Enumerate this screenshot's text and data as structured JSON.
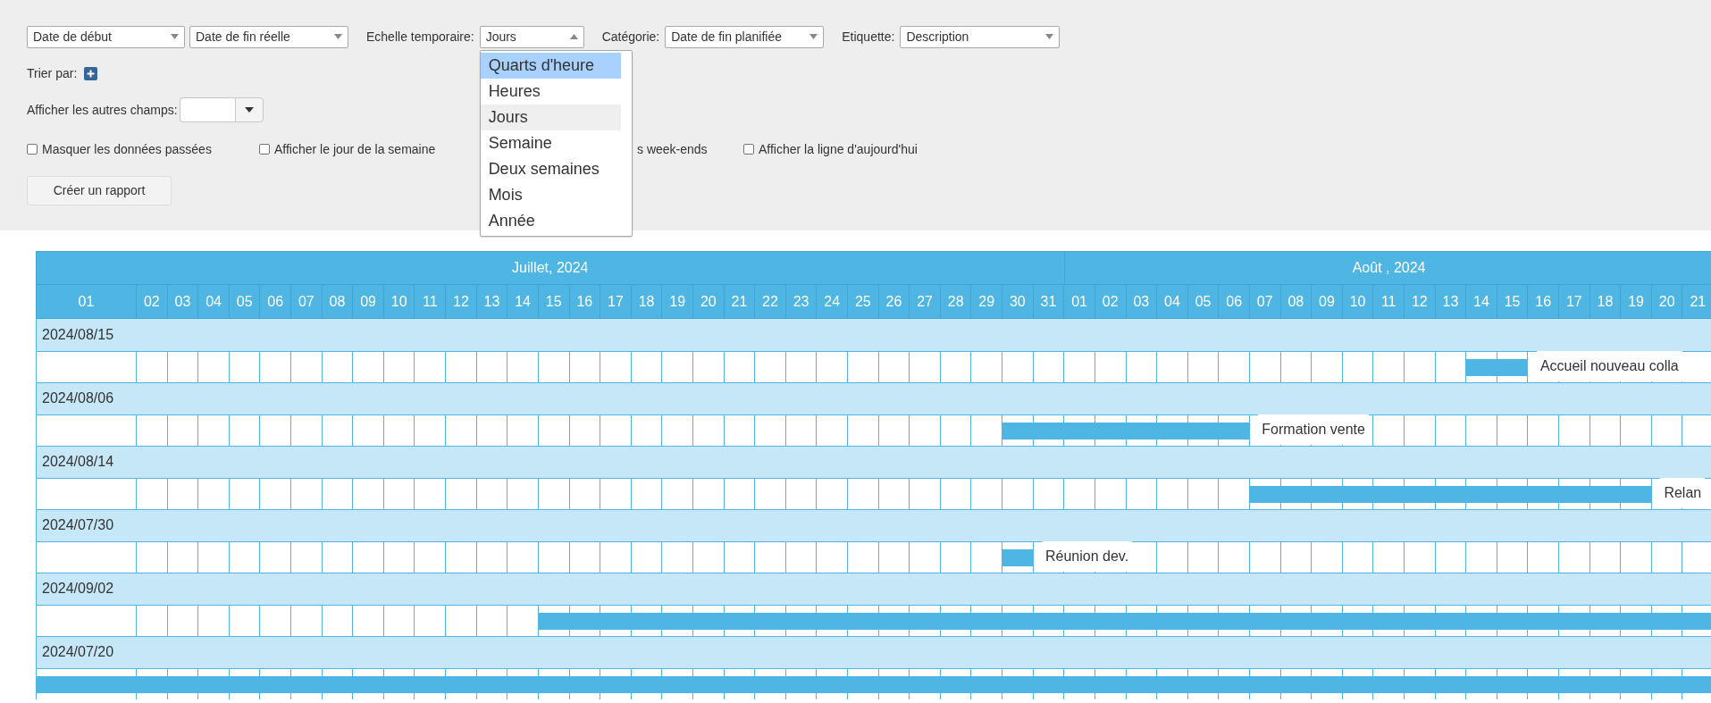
{
  "filters": {
    "selects": [
      {
        "kind": "plain",
        "value": "Date de début",
        "open": false
      },
      {
        "kind": "plain",
        "value": "Date de fin réelle",
        "open": false
      },
      {
        "kind": "labeled",
        "label": "Echelle temporaire:",
        "value": "Jours",
        "open": true
      },
      {
        "kind": "labeled",
        "label": "Catégorie:",
        "value": "Date de fin planifiée",
        "open": false
      },
      {
        "kind": "labeled",
        "label": "Etiquette:",
        "value": "Description",
        "open": false
      }
    ],
    "scale_options": [
      {
        "label": "Quarts d'heure",
        "hovered": true,
        "selected": false
      },
      {
        "label": "Heures",
        "hovered": false,
        "selected": false
      },
      {
        "label": "Jours",
        "hovered": false,
        "selected": true
      },
      {
        "label": "Semaine",
        "hovered": false,
        "selected": false
      },
      {
        "label": "Deux semaines",
        "hovered": false,
        "selected": false
      },
      {
        "label": "Mois",
        "hovered": false,
        "selected": false
      },
      {
        "label": "Année",
        "hovered": false,
        "selected": false
      }
    ],
    "sort_label": "Trier par:",
    "other_fields_label": "Afficher les autres champs:",
    "checkboxes": [
      {
        "label": "Masquer les données passées",
        "checked": false
      },
      {
        "label": "Afficher le jour de la semaine",
        "checked": false
      },
      {
        "label": "s week-ends"
      },
      {
        "label": "Afficher la ligne d'aujourd'hui",
        "checked": false
      }
    ],
    "report_button": "Créer un rapport"
  },
  "gantt": {
    "months": [
      {
        "label": "Juillet, 2024",
        "days": [
          "01",
          "02",
          "03",
          "04",
          "05",
          "06",
          "07",
          "08",
          "09",
          "10",
          "11",
          "12",
          "13",
          "14",
          "15",
          "16",
          "17",
          "18",
          "19",
          "20",
          "21",
          "22",
          "23",
          "24",
          "25",
          "26",
          "27",
          "28",
          "29",
          "30",
          "31"
        ]
      },
      {
        "label": "Août , 2024",
        "days": [
          "01",
          "02",
          "03",
          "04",
          "05",
          "06",
          "07",
          "08",
          "09",
          "10",
          "11",
          "12",
          "13",
          "14",
          "15",
          "16",
          "17",
          "18",
          "19",
          "20",
          "21"
        ]
      }
    ],
    "groups": [
      {
        "title": "2024/08/15",
        "label": "Accueil nouveau colla",
        "cells": [
          false,
          false,
          false,
          false,
          false,
          false,
          false,
          false,
          false,
          false,
          false,
          false,
          false,
          false,
          false,
          false,
          false,
          false,
          false,
          false,
          false,
          false,
          false,
          false,
          false,
          false,
          false,
          false,
          false,
          false,
          false,
          false,
          false,
          false,
          false,
          false,
          false,
          false,
          false,
          false,
          false,
          false,
          false,
          false,
          true,
          true,
          false,
          false,
          false,
          false,
          false,
          false
        ]
      },
      {
        "title": "2024/08/06",
        "label": "Formation vente",
        "cells": [
          false,
          false,
          false,
          false,
          false,
          false,
          false,
          false,
          false,
          false,
          false,
          false,
          false,
          false,
          false,
          false,
          false,
          false,
          false,
          false,
          false,
          false,
          false,
          false,
          false,
          false,
          false,
          false,
          false,
          true,
          true,
          true,
          true,
          true,
          true,
          true,
          true,
          false,
          false,
          false,
          false,
          false,
          false,
          false,
          false,
          false,
          false,
          false,
          false,
          false,
          false,
          false
        ]
      },
      {
        "title": "2024/08/14",
        "label": "Relan",
        "cells": [
          false,
          false,
          false,
          false,
          false,
          false,
          false,
          false,
          false,
          false,
          false,
          false,
          false,
          false,
          false,
          false,
          false,
          false,
          false,
          false,
          false,
          false,
          false,
          false,
          false,
          false,
          false,
          false,
          false,
          false,
          false,
          false,
          false,
          false,
          false,
          false,
          false,
          true,
          true,
          true,
          true,
          true,
          true,
          true,
          true,
          true,
          true,
          true,
          true,
          true,
          false,
          false
        ]
      },
      {
        "title": "2024/07/30",
        "label": "Réunion dev.",
        "cells": [
          false,
          false,
          false,
          false,
          false,
          false,
          false,
          false,
          false,
          false,
          false,
          false,
          false,
          false,
          false,
          false,
          false,
          false,
          false,
          false,
          false,
          false,
          false,
          false,
          false,
          false,
          false,
          false,
          false,
          true,
          false,
          false,
          false,
          false,
          false,
          false,
          false,
          false,
          false,
          false,
          false,
          false,
          false,
          false,
          false,
          false,
          false,
          false,
          false,
          false,
          false,
          false
        ]
      },
      {
        "title": "2024/09/02",
        "cells": [
          false,
          false,
          false,
          false,
          false,
          false,
          false,
          false,
          false,
          false,
          false,
          false,
          false,
          false,
          true,
          true,
          true,
          true,
          true,
          true,
          true,
          true,
          true,
          true,
          true,
          true,
          true,
          true,
          true,
          true,
          true,
          true,
          true,
          true,
          true,
          true,
          true,
          true,
          true,
          true,
          true,
          true,
          true,
          true,
          true,
          true,
          true,
          true,
          true,
          true,
          true,
          true
        ]
      },
      {
        "title": "2024/07/20",
        "cells": [
          true,
          true,
          true,
          true,
          true,
          true,
          true,
          true,
          true,
          true,
          true,
          true,
          true,
          true,
          true,
          true,
          true,
          true,
          true,
          true,
          true,
          true,
          true,
          true,
          true,
          true,
          true,
          true,
          true,
          true,
          true,
          true,
          true,
          true,
          true,
          true,
          true,
          true,
          true,
          true,
          true,
          true,
          true,
          true,
          true,
          true,
          true,
          true,
          true,
          true,
          true,
          true
        ]
      }
    ]
  }
}
